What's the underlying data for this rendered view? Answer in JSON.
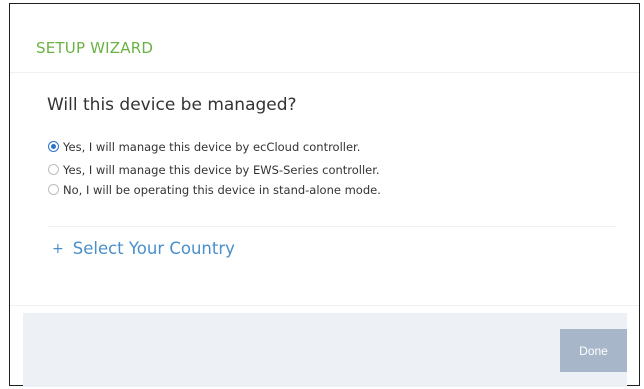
{
  "wizard": {
    "title": "SETUP WIZARD",
    "question": "Will this device be managed?",
    "options": [
      {
        "label": "Yes, I will manage this device by ecCloud controller.",
        "selected": true
      },
      {
        "label": "Yes, I will manage this device by EWS-Series controller.",
        "selected": false
      },
      {
        "label": "No, I will be operating this device in stand-alone mode.",
        "selected": false
      }
    ],
    "country_expander": {
      "icon": "+",
      "label": "Select Your Country"
    },
    "done_label": "Done"
  },
  "colors": {
    "title": "#6ab245",
    "link": "#4a8fc9",
    "radio_selected": "#2a73c9",
    "footer_bg": "#edf1f6",
    "done_button_bg": "#a7b6c9"
  }
}
